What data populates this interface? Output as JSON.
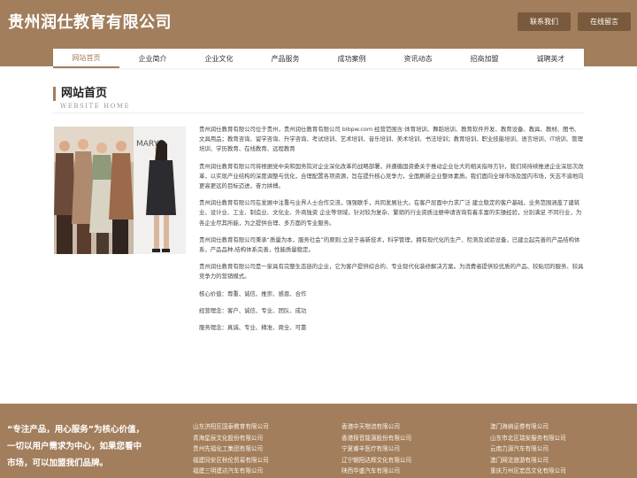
{
  "header": {
    "logo": "贵州润仕教育有限公司",
    "contact_label": "联系我们",
    "message_label": "在线留言"
  },
  "nav": {
    "items": [
      "网站首页",
      "企业简介",
      "企业文化",
      "产品服务",
      "成功案例",
      "资讯动态",
      "招商加盟",
      "诚聘英才"
    ]
  },
  "section": {
    "title": "网站首页",
    "subtitle": "WEBSITE HOME"
  },
  "content": {
    "paragraphs": [
      "贵州润仕教育有限公司位于贵州，贵州润仕教育有限公司 blbpw.com 经营范围含:体育培训、舞蹈培训、教育软件开发、教育设备、教具、教材、图书、文具用品；教育咨询、留学咨询、升学咨询、考试培训、艺术培训、音乐培训、美术培训、书法培训；教育培训、职业技能培训、语言培训、IT培训、管理培训、学历教育、在线教育、远程教育",
      "贵州润仕教育有限公司将根据党中央和国务院对企业深化改革的战略部署，并遵循国资委关于推动企业壮大的相关指导方针，我们将持续推进企业深层次改革，以实现产业结构的深度调整与优化，合理配置各项资源，旨在提升核心竞争力，全面刷新企业整体素质。我们面向全球市场及国内市场，矢志不渝地向更高更远的目标迈进，奋力拼搏。",
      "贵州润仕教育有限公司在发展中注重与业界人士合作交流，强强联手，共同发展壮大。在客户层面中力求广泛 建立稳定的客户基础，业务范围涵盖了建筑业、设计业、工业、制造业、文化业、外商独资 企业等领域，针对较为复杂、繁琐的行业资质注册申请咨询有着丰富的实操经验，分别满足 不同行业，为各企业尽其所能，为之提供合理、多方面的专业服务。",
      "贵州润仕教育有限公司秉承“质量为本，服务社会”的原则,立足于高新技术，科学管理，拥有现代化的生产、检测及试验设备，已建立起完善的产品结构体系，产品品种,结构体系完善，性能质量稳定。",
      "贵州润仕教育有限公司是一家具有完整生态链的企业，它为客户提供综合的、专业现代化装修解决方案。为消费者提供较优质的产品、较贴切的服务、较具竞争力的营销模式。",
      "核心价值：尊重、诚信、推崇、感恩、合作",
      "经营理念：客户、诚信、专业、团队、成功",
      "服务理念：真诚、专业、精准、周全、可靠"
    ]
  },
  "footer": {
    "slogan": "“专注产品，用心服务”为核心价值，一切以用户需求为中心，如果您看中市场，可以加盟我们品牌。",
    "col1": [
      "山东济阳区国泰教育有限公司",
      "青海星辰文化股份有限公司",
      "贵州先福化工集团有限公司",
      "福建同安区秋伦贸易有限公司",
      "福建三明建达汽车有限公司"
    ],
    "col2": [
      "香港中天物流有限公司",
      "香港探音能源股份有限公司",
      "宁夏睿丰医疗有限公司",
      "辽宁朝阳达辉文化有限公司",
      "陕西华盛汽车有限公司"
    ],
    "col3": [
      "澳门海纳证券有限公司",
      "山东市北区瑞安服务有限公司",
      "云南力源汽车有限公司",
      "澳门网览旅游有限公司",
      "重庆万州区宏昌文化有限公司"
    ]
  },
  "colors": {
    "brand": "#a27e5c",
    "button_dark": "#7a5a3c"
  }
}
